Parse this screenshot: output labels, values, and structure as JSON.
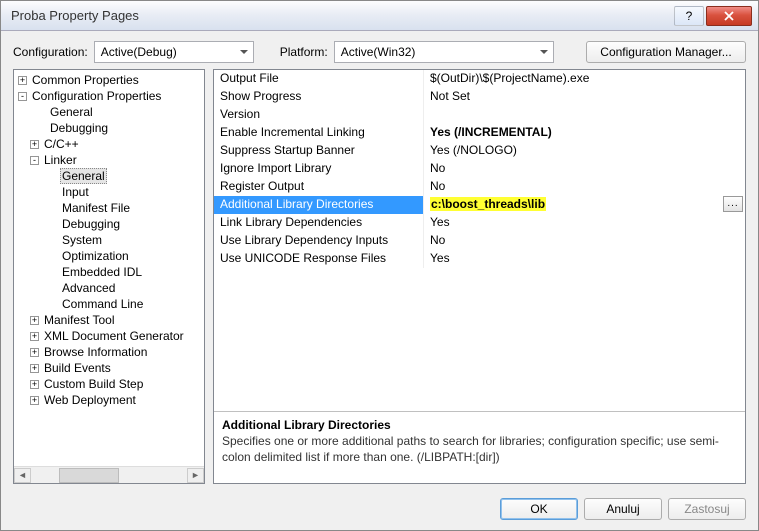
{
  "window": {
    "title": "Proba Property Pages"
  },
  "top": {
    "config_label": "Configuration:",
    "config_value": "Active(Debug)",
    "platform_label": "Platform:",
    "platform_value": "Active(Win32)",
    "config_manager": "Configuration Manager..."
  },
  "tree": {
    "nodes": [
      {
        "label": "Common Properties",
        "depth": 0,
        "expander": "+"
      },
      {
        "label": "Configuration Properties",
        "depth": 0,
        "expander": "-"
      },
      {
        "label": "General",
        "depth": 1
      },
      {
        "label": "Debugging",
        "depth": 1
      },
      {
        "label": "C/C++",
        "depth": 1,
        "expander": "+"
      },
      {
        "label": "Linker",
        "depth": 1,
        "expander": "-"
      },
      {
        "label": "General",
        "depth": 2,
        "selected": true
      },
      {
        "label": "Input",
        "depth": 2
      },
      {
        "label": "Manifest File",
        "depth": 2
      },
      {
        "label": "Debugging",
        "depth": 2
      },
      {
        "label": "System",
        "depth": 2
      },
      {
        "label": "Optimization",
        "depth": 2
      },
      {
        "label": "Embedded IDL",
        "depth": 2
      },
      {
        "label": "Advanced",
        "depth": 2
      },
      {
        "label": "Command Line",
        "depth": 2
      },
      {
        "label": "Manifest Tool",
        "depth": 1,
        "expander": "+"
      },
      {
        "label": "XML Document Generator",
        "depth": 1,
        "expander": "+"
      },
      {
        "label": "Browse Information",
        "depth": 1,
        "expander": "+"
      },
      {
        "label": "Build Events",
        "depth": 1,
        "expander": "+"
      },
      {
        "label": "Custom Build Step",
        "depth": 1,
        "expander": "+"
      },
      {
        "label": "Web Deployment",
        "depth": 1,
        "expander": "+"
      }
    ]
  },
  "props": [
    {
      "name": "Output File",
      "value": "$(OutDir)\\$(ProjectName).exe"
    },
    {
      "name": "Show Progress",
      "value": "Not Set"
    },
    {
      "name": "Version",
      "value": ""
    },
    {
      "name": "Enable Incremental Linking",
      "value": "Yes (/INCREMENTAL)",
      "bold": true
    },
    {
      "name": "Suppress Startup Banner",
      "value": "Yes (/NOLOGO)"
    },
    {
      "name": "Ignore Import Library",
      "value": "No"
    },
    {
      "name": "Register Output",
      "value": "No"
    },
    {
      "name": "Additional Library Directories",
      "value": "c:\\boost_threads\\lib",
      "selected": true,
      "highlight": true
    },
    {
      "name": "Link Library Dependencies",
      "value": "Yes"
    },
    {
      "name": "Use Library Dependency Inputs",
      "value": "No"
    },
    {
      "name": "Use UNICODE Response Files",
      "value": "Yes"
    }
  ],
  "desc": {
    "title": "Additional Library Directories",
    "text": "Specifies one or more additional paths to search for libraries; configuration specific; use semi-colon delimited list if more than one.     (/LIBPATH:[dir])"
  },
  "footer": {
    "ok": "OK",
    "cancel": "Anuluj",
    "apply": "Zastosuj"
  }
}
